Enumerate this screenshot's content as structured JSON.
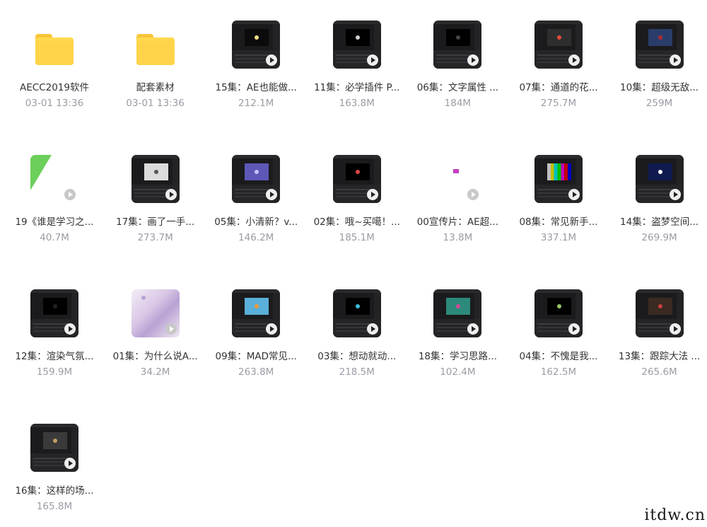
{
  "files": [
    {
      "type": "folder",
      "name": "AECC2019软件",
      "meta": "03-01 13:36",
      "icon": "folder-icon"
    },
    {
      "type": "folder",
      "name": "配套素材",
      "meta": "03-01 13:36",
      "icon": "folder-icon"
    },
    {
      "type": "video",
      "name": "15集：AE也能做...",
      "meta": "212.1M",
      "icon": "video-thumbnail",
      "screen": "#0b0b0b",
      "accent": "#f3e38a"
    },
    {
      "type": "video",
      "name": "11集：必学插件 P...",
      "meta": "163.8M",
      "icon": "video-thumbnail",
      "screen": "#000000",
      "accent": "#d0d0d0"
    },
    {
      "type": "video",
      "name": "06集：文字属性 ...",
      "meta": "184M",
      "icon": "video-thumbnail",
      "screen": "#000000",
      "accent": "#444444"
    },
    {
      "type": "video",
      "name": "07集：通道的花...",
      "meta": "275.7M",
      "icon": "video-thumbnail",
      "screen": "#2e2e2e",
      "accent": "#e84a3a"
    },
    {
      "type": "video",
      "name": "10集：超级无敌...",
      "meta": "259M",
      "icon": "video-thumbnail",
      "screen": "#2a3d6a",
      "accent": "#b12b30"
    },
    {
      "type": "video",
      "name": "19《谁是学习之...",
      "meta": "40.7M",
      "icon": "video-thumbnail",
      "style": "light",
      "accent": "#6ccf5a"
    },
    {
      "type": "video",
      "name": "17集：画了一手...",
      "meta": "273.7M",
      "icon": "video-thumbnail",
      "screen": "#dcdcdc",
      "accent": "#555555"
    },
    {
      "type": "video",
      "name": "05集：小清新？v...",
      "meta": "146.2M",
      "icon": "video-thumbnail",
      "screen": "#5d57b8",
      "accent": "#c9c2ff"
    },
    {
      "type": "video",
      "name": "02集：哦~买噶！...",
      "meta": "185.1M",
      "icon": "video-thumbnail",
      "screen": "#000000",
      "accent": "#e04545"
    },
    {
      "type": "video",
      "name": "00宣传片：AE超...",
      "meta": "13.8M",
      "icon": "video-thumbnail",
      "style": "light",
      "accent": "#c040c0"
    },
    {
      "type": "video",
      "name": "08集：常见新手...",
      "meta": "337.1M",
      "icon": "video-thumbnail",
      "style": "bars",
      "accent": "#ffffff"
    },
    {
      "type": "video",
      "name": "14集：盗梦空间...",
      "meta": "269.9M",
      "icon": "video-thumbnail",
      "screen": "#101a50",
      "accent": "#ffffff"
    },
    {
      "type": "video",
      "name": "12集：渲染气氛...",
      "meta": "159.9M",
      "icon": "video-thumbnail",
      "screen": "#000000",
      "accent": "#222222"
    },
    {
      "type": "video",
      "name": "01集：为什么说A...",
      "meta": "34.2M",
      "icon": "video-thumbnail",
      "style": "anime",
      "accent": "#b8a2d3"
    },
    {
      "type": "video",
      "name": "09集：MAD常见...",
      "meta": "263.8M",
      "icon": "video-thumbnail",
      "screen": "#5ab0d9",
      "accent": "#f29a3a"
    },
    {
      "type": "video",
      "name": "03集：想动就动...",
      "meta": "218.5M",
      "icon": "video-thumbnail",
      "screen": "#000000",
      "accent": "#39c0d8"
    },
    {
      "type": "video",
      "name": "18集：学习思路...",
      "meta": "102.4M",
      "icon": "video-thumbnail",
      "screen": "#2c8a7a",
      "accent": "#d04a9a"
    },
    {
      "type": "video",
      "name": "04集：不愧是我...",
      "meta": "162.5M",
      "icon": "video-thumbnail",
      "screen": "#000000",
      "accent": "#9ac76a"
    },
    {
      "type": "video",
      "name": "13集：跟踪大法 ...",
      "meta": "265.6M",
      "icon": "video-thumbnail",
      "screen": "#3a2a22",
      "accent": "#c84040"
    },
    {
      "type": "video",
      "name": "16集：这样的场...",
      "meta": "165.8M",
      "icon": "video-thumbnail",
      "screen": "#3a3a3a",
      "accent": "#c0a060"
    }
  ],
  "watermark": "itdw.cn"
}
